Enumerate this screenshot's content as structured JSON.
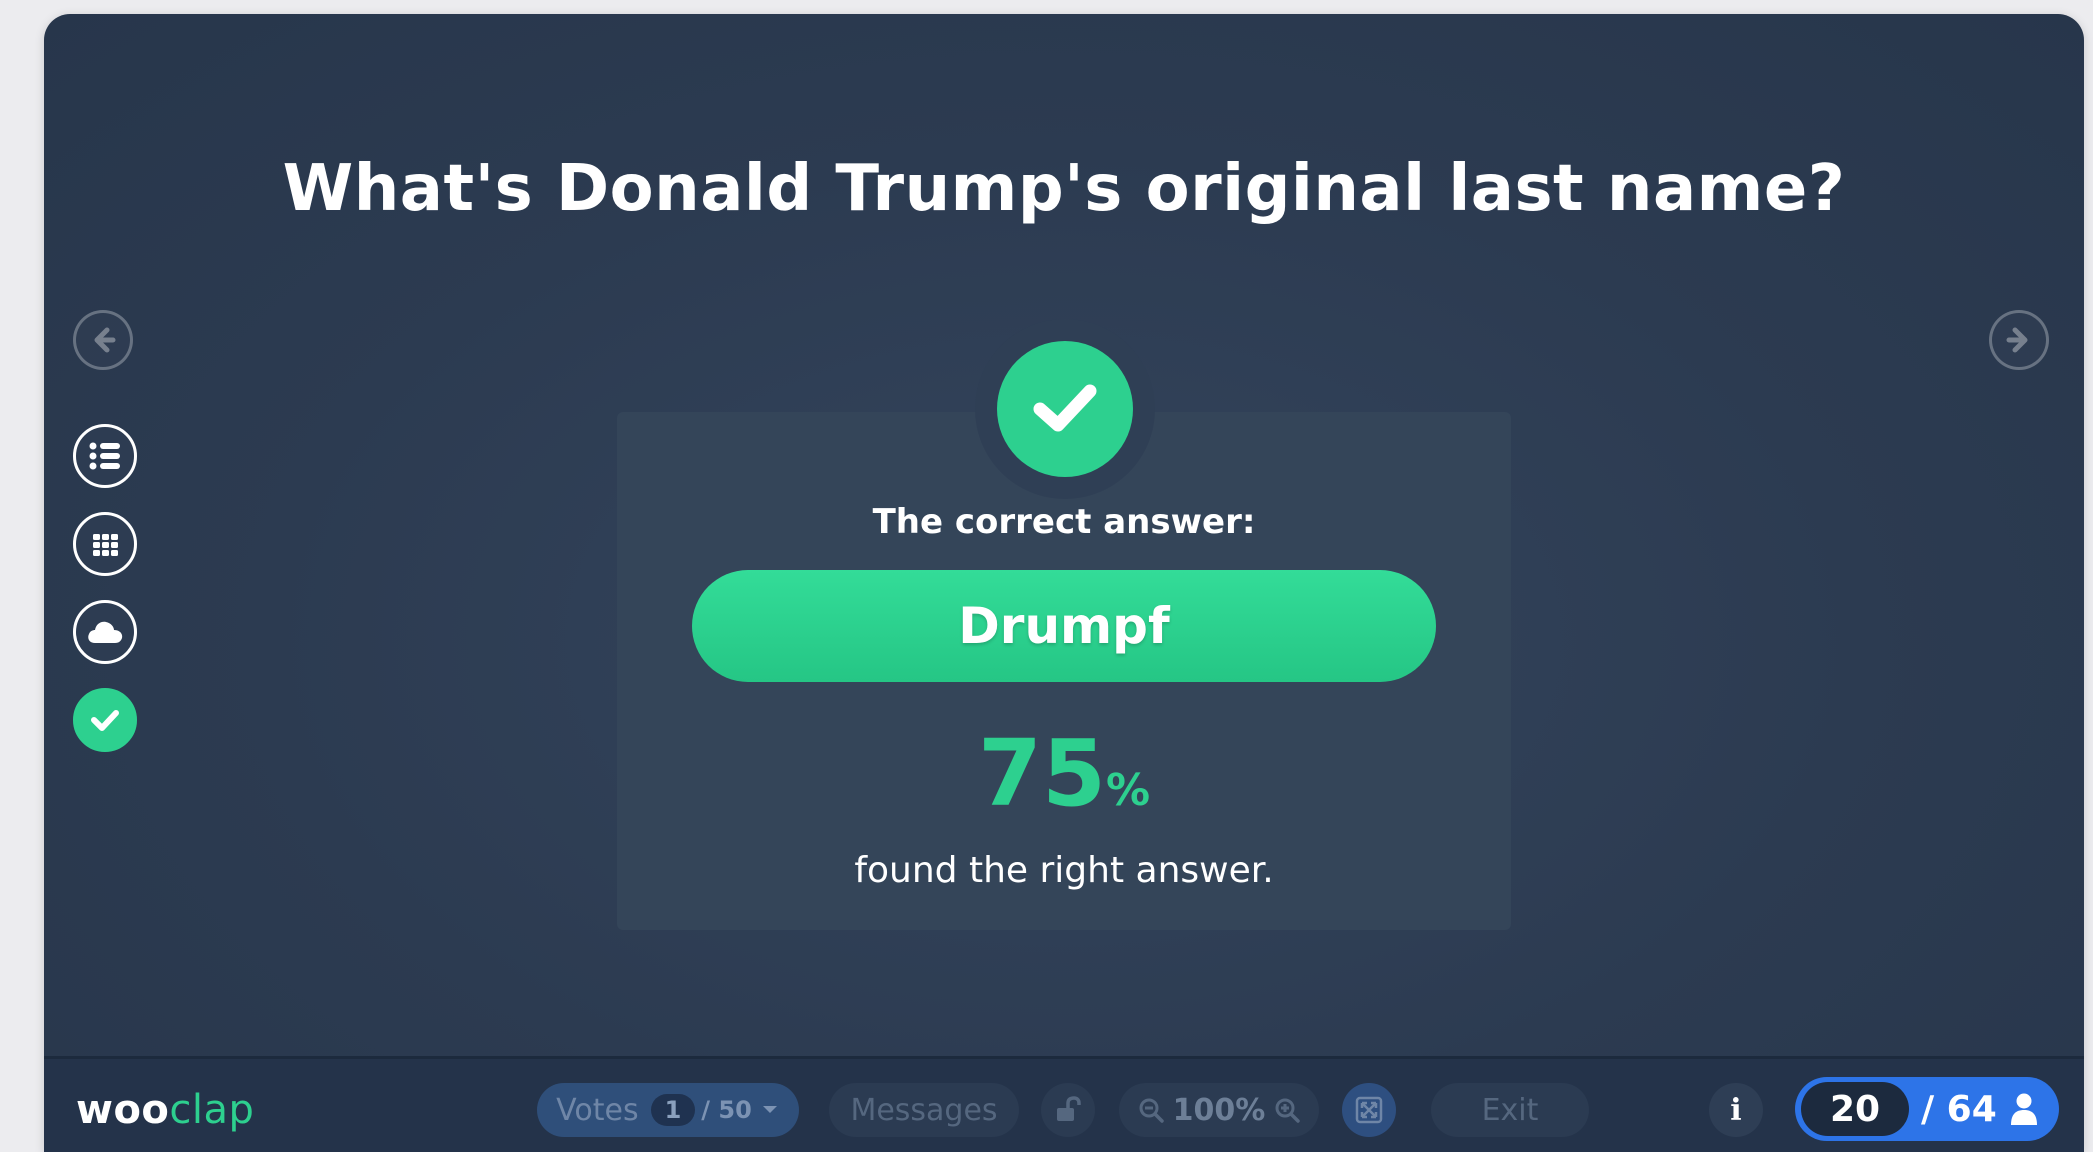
{
  "question": "What's Donald Trump's original last name?",
  "result": {
    "label": "The correct answer:",
    "answer": "Drumpf",
    "percent": "75",
    "percent_sign": "%",
    "caption": "found the right answer."
  },
  "sidebar": {
    "items": [
      {
        "icon": "list-icon"
      },
      {
        "icon": "grid-icon"
      },
      {
        "icon": "cloud-icon"
      },
      {
        "icon": "checkmark-icon",
        "active": true
      }
    ]
  },
  "toolbar": {
    "logo_woo": "woo",
    "logo_clap": "clap",
    "votes_label": "Votes",
    "votes_count": "1",
    "votes_total": "/ 50",
    "messages_label": "Messages",
    "zoom_level": "100%",
    "exit_label": "Exit",
    "info_label": "i",
    "participants_now": "20",
    "participants_total": "/ 64"
  },
  "colors": {
    "accent": "#2dd08f",
    "background": "#2c3b51",
    "bar": "#24334a",
    "participants": "#2d74e8"
  }
}
